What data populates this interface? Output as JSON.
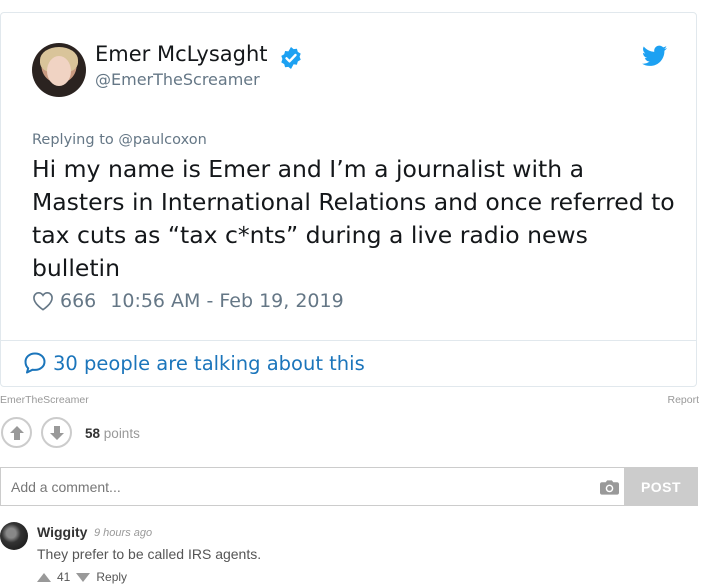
{
  "tweet": {
    "display_name": "Emer McLysaght",
    "handle": "@EmerTheScreamer",
    "replying_label": "Replying to",
    "replying_to": "@paulcoxon",
    "text": "Hi my name is Emer and I’m a journalist with a Masters in International Relations and once referred to tax cuts as “tax c*nts” during a live radio news bulletin",
    "likes": "666",
    "timestamp": "10:56 AM - Feb 19, 2019",
    "talking": "30 people are talking about this",
    "colors": {
      "link": "#1b75bb",
      "verified": "#1da1f2",
      "bird": "#1da1f2",
      "muted": "#657786"
    },
    "icons": [
      "verified-badge-icon",
      "twitter-bird-icon",
      "heart-icon",
      "speech-bubble-icon"
    ]
  },
  "embed_footer": {
    "source": "EmerTheScreamer",
    "report": "Report"
  },
  "votes": {
    "count": "58",
    "label": "points"
  },
  "comment_form": {
    "placeholder": "Add a comment...",
    "post_label": "POST"
  },
  "comments": [
    {
      "user": "Wiggity",
      "time": "9 hours ago",
      "text": "They prefer to be called IRS agents.",
      "votes": "41",
      "reply_label": "Reply"
    }
  ]
}
